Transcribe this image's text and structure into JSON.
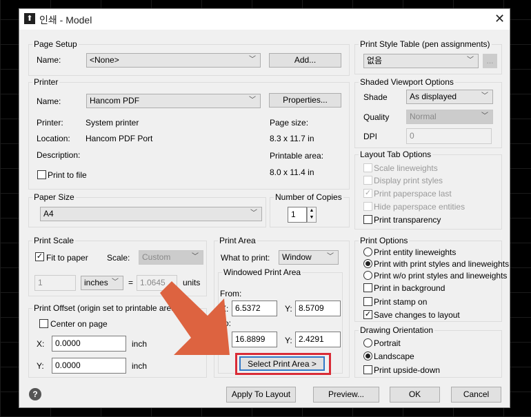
{
  "title": "인쇄 - Model",
  "page_setup": {
    "label": "Page Setup",
    "name_label": "Name:",
    "name_value": "<None>",
    "add": "Add..."
  },
  "printer": {
    "label": "Printer",
    "name_label": "Name:",
    "name_value": "Hancom PDF",
    "properties": "Properties...",
    "printer_label": "Printer:",
    "printer_value": "System printer",
    "location_label": "Location:",
    "location_value": "Hancom PDF Port",
    "description_label": "Description:",
    "print_to_file": "Print to file",
    "print_to_file_checked": false,
    "page_size_label": "Page size:",
    "page_size_value": "8.3 x 11.7 in",
    "printable_label": "Printable area:",
    "printable_value": "8.0 x 11.4 in"
  },
  "paper_size": {
    "label": "Paper Size",
    "value": "A4"
  },
  "copies": {
    "label": "Number of Copies",
    "value": "1"
  },
  "print_scale": {
    "label": "Print Scale",
    "fit": "Fit to paper",
    "fit_checked": true,
    "scale_label": "Scale:",
    "scale_value": "Custom",
    "left": "1",
    "unit": "inches",
    "eq": "=",
    "right": "1.0645",
    "units": "units"
  },
  "print_offset": {
    "label": "Print Offset (origin set to printable area)",
    "center": "Center on page",
    "center_checked": false,
    "x_label": "X:",
    "x": "0.0000",
    "y_label": "Y:",
    "y": "0.0000",
    "unit": "inch"
  },
  "print_area": {
    "label": "Print Area",
    "what_label": "What to print:",
    "what_value": "Window",
    "windowed_label": "Windowed Print Area",
    "from_label": "From:",
    "to_label": "To:",
    "x_label": "X:",
    "y_label": "Y:",
    "from_x": "6.5372",
    "from_y": "8.5709",
    "to_x": "16.8899",
    "to_y": "2.4291",
    "select_button": "Select Print Area >"
  },
  "style_table": {
    "label": "Print Style Table (pen assignments)",
    "value": "없음",
    "edit": "..."
  },
  "shaded": {
    "label": "Shaded Viewport Options",
    "shade_label": "Shade",
    "shade_value": "As displayed",
    "quality_label": "Quality",
    "quality_value": "Normal",
    "dpi_label": "DPI",
    "dpi_value": "0"
  },
  "layout_tab": {
    "label": "Layout Tab Options",
    "items": [
      {
        "label": "Scale lineweights",
        "checked": false,
        "disabled": true
      },
      {
        "label": "Display print styles",
        "checked": false,
        "disabled": true
      },
      {
        "label": "Print paperspace last",
        "checked": true,
        "disabled": true
      },
      {
        "label": "Hide paperspace entities",
        "checked": false,
        "disabled": true
      },
      {
        "label": "Print transparency",
        "checked": false,
        "disabled": false
      }
    ]
  },
  "print_options": {
    "label": "Print Options",
    "items": [
      {
        "label": "Print entity lineweights",
        "type": "radio",
        "checked": false
      },
      {
        "label": "Print with print styles and lineweights",
        "type": "radio",
        "checked": true
      },
      {
        "label": "Print w/o print styles and lineweights",
        "type": "radio",
        "checked": false
      },
      {
        "label": "Print in background",
        "type": "check",
        "checked": false
      },
      {
        "label": "Print stamp on",
        "type": "check",
        "checked": false
      },
      {
        "label": "Save changes to layout",
        "type": "check",
        "checked": true
      }
    ]
  },
  "orientation": {
    "label": "Drawing Orientation",
    "items": [
      {
        "label": "Portrait",
        "type": "radio",
        "checked": false
      },
      {
        "label": "Landscape",
        "type": "radio",
        "checked": true
      },
      {
        "label": "Print upside-down",
        "type": "check",
        "checked": false
      }
    ]
  },
  "footer": {
    "help": "?",
    "apply": "Apply To Layout",
    "preview": "Preview...",
    "ok": "OK",
    "cancel": "Cancel"
  },
  "annotation": {
    "arrow_color": "#dd6340",
    "highlight_color": "#d92b36"
  }
}
